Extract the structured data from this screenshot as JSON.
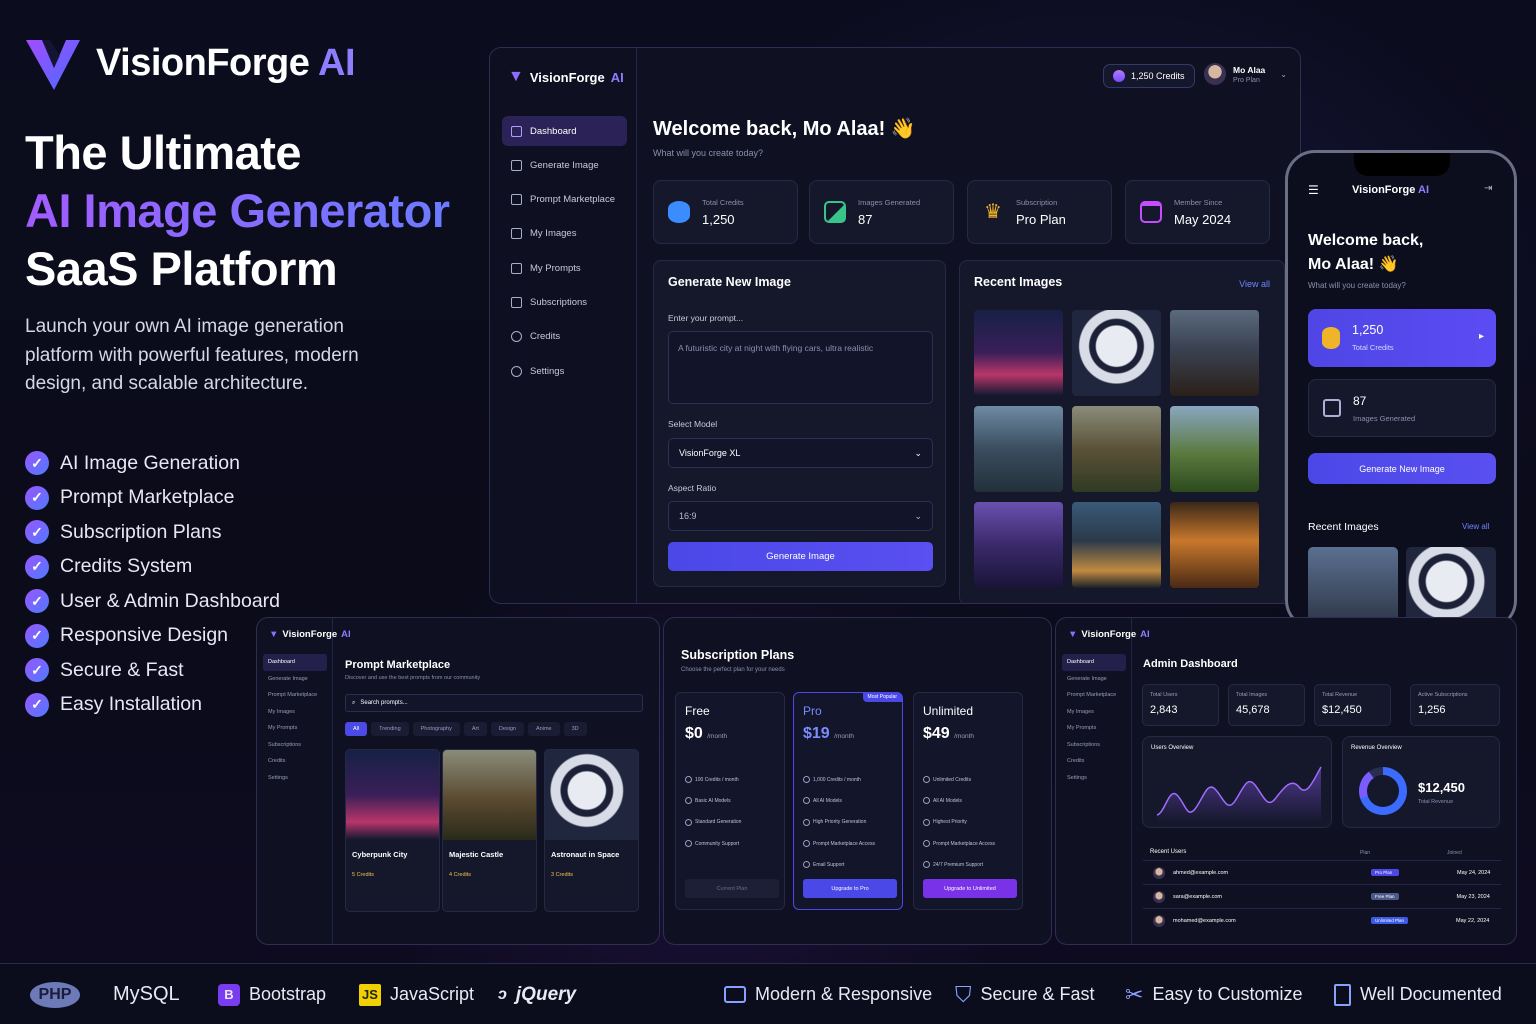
{
  "brand": {
    "name": "VisionForge",
    "ai": "AI"
  },
  "hero": {
    "line1": "The Ultimate",
    "line2": "AI Image Generator",
    "line3": "SaaS Platform",
    "lead": "Launch your own AI image generation platform with powerful features, modern design, and scalable architecture.",
    "features": [
      "AI Image Generation",
      "Prompt Marketplace",
      "Subscription Plans",
      "Credits System",
      "User & Admin Dashboard",
      "Responsive Design",
      "Secure & Fast",
      "Easy Installation"
    ]
  },
  "dashboard": {
    "nav": [
      "Dashboard",
      "Generate Image",
      "Prompt Marketplace",
      "My Images",
      "My Prompts",
      "Subscriptions",
      "Credits",
      "Settings"
    ],
    "credits_badge": "1,250 Credits",
    "user": {
      "name": "Mo Alaa",
      "plan": "Pro Plan"
    },
    "welcome": "Welcome back, Mo Alaa! 👋",
    "subtitle": "What will you create today?",
    "stats": [
      {
        "label": "Total Credits",
        "value": "1,250",
        "color": "#3b8cff"
      },
      {
        "label": "Images Generated",
        "value": "87",
        "color": "#37c58a"
      },
      {
        "label": "Subscription",
        "value": "Pro Plan",
        "color": "#f0b429"
      },
      {
        "label": "Member Since",
        "value": "May 2024",
        "color": "#c64cff"
      }
    ],
    "generate": {
      "title": "Generate New Image",
      "prompt_label": "Enter your prompt...",
      "prompt_value": "A futuristic city at night with flying cars, ultra realistic",
      "model_label": "Select Model",
      "model_value": "VisionForge XL",
      "ratio_label": "Aspect Ratio",
      "ratio_value": "16:9",
      "button": "Generate Image"
    },
    "recent": {
      "title": "Recent Images",
      "view_all": "View all"
    }
  },
  "phone": {
    "welcome1": "Welcome back,",
    "welcome2": "Mo Alaa! 👋",
    "subtitle": "What will you create today?",
    "credits_value": "1,250",
    "credits_label": "Total Credits",
    "images_value": "87",
    "images_label": "Images Generated",
    "button": "Generate New Image",
    "recent": "Recent Images",
    "view_all": "View all"
  },
  "marketplace": {
    "title": "Prompt Marketplace",
    "subtitle": "Discover and use the best prompts from our community",
    "search": "Search prompts...",
    "filters": [
      "All",
      "Trending",
      "Photography",
      "Art",
      "Design",
      "Anime",
      "3D"
    ],
    "nav": [
      "Dashboard",
      "Generate Image",
      "Prompt Marketplace",
      "My Images",
      "My Prompts",
      "Subscriptions",
      "Credits",
      "Settings"
    ],
    "cards": [
      {
        "name": "Cyberpunk City",
        "credits": "5 Credits"
      },
      {
        "name": "Majestic Castle",
        "credits": "4 Credits"
      },
      {
        "name": "Astronaut in Space",
        "credits": "3 Credits"
      }
    ]
  },
  "subscriptions": {
    "title": "Subscription Plans",
    "subtitle": "Choose the perfect plan for your needs",
    "plans": [
      {
        "name": "Free",
        "price": "$0",
        "per": "/month",
        "features": [
          "100 Credits / month",
          "Basic AI Models",
          "Standard Generation",
          "Community Support"
        ],
        "button": "Current Plan"
      },
      {
        "name": "Pro",
        "price": "$19",
        "per": "/month",
        "badge": "Most Popular",
        "features": [
          "1,000 Credits / month",
          "All AI Models",
          "High Priority Generation",
          "Prompt Marketplace Access",
          "Email Support"
        ],
        "button": "Upgrade to Pro"
      },
      {
        "name": "Unlimited",
        "price": "$49",
        "per": "/month",
        "features": [
          "Unlimited Credits",
          "All AI Models",
          "Highest Priority",
          "Prompt Marketplace Access",
          "24/7 Premium Support"
        ],
        "button": "Upgrade to Unlimited"
      }
    ]
  },
  "admin": {
    "title": "Admin Dashboard",
    "nav": [
      "Dashboard",
      "Generate Image",
      "Prompt Marketplace",
      "My Images",
      "My Prompts",
      "Subscriptions",
      "Credits",
      "Settings"
    ],
    "stats": [
      {
        "label": "Total Users",
        "value": "2,843"
      },
      {
        "label": "Total Images",
        "value": "45,678"
      },
      {
        "label": "Total Revenue",
        "value": "$12,450"
      },
      {
        "label": "Active Subscriptions",
        "value": "1,256"
      }
    ],
    "users_overview": "Users Overview",
    "revenue_overview": "Revenue Overview",
    "revenue_value": "$12,450",
    "revenue_label": "Total Revenue",
    "recent_users": "Recent Users",
    "col_plan": "Plan",
    "col_joined": "Joined",
    "users": [
      {
        "email": "ahmed@example.com",
        "plan": "Pro Plan",
        "date": "May 24, 2024"
      },
      {
        "email": "sara@example.com",
        "plan": "Free Plan",
        "date": "May 23, 2024"
      },
      {
        "email": "mohamed@example.com",
        "plan": "Unlimited Plan",
        "date": "May 22, 2024"
      }
    ]
  },
  "footer": {
    "tech": [
      "PHP",
      "MySQL",
      "Bootstrap",
      "JavaScript",
      "jQuery"
    ],
    "features": [
      "Modern & Responsive",
      "Secure & Fast",
      "Easy to Customize",
      "Well Documented"
    ]
  }
}
